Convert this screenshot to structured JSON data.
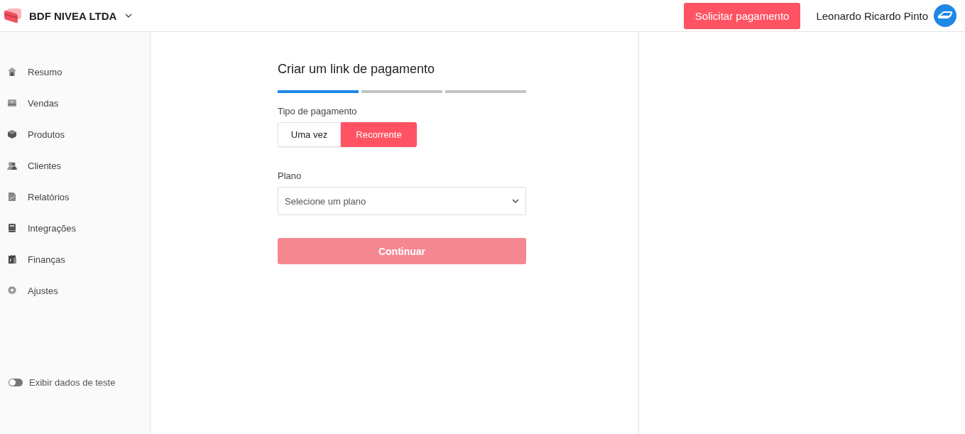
{
  "header": {
    "company": "BDF NIVEA LTDA",
    "request_button": "Solicitar pagamento",
    "user_name": "Leonardo Ricardo Pinto"
  },
  "sidebar": {
    "items": [
      {
        "label": "Resumo",
        "kind": "home"
      },
      {
        "label": "Vendas",
        "kind": "sales"
      },
      {
        "label": "Produtos",
        "kind": "box"
      },
      {
        "label": "Clientes",
        "kind": "people"
      },
      {
        "label": "Relatórios",
        "kind": "report"
      },
      {
        "label": "Integrações",
        "kind": "book"
      },
      {
        "label": "Finanças",
        "kind": "money"
      },
      {
        "label": "Ajustes",
        "kind": "gear"
      }
    ],
    "test_toggle": {
      "label": "Exibir dados de teste",
      "on": false
    }
  },
  "form": {
    "title": "Criar um link de pagamento",
    "steps": [
      {
        "current": true
      },
      {
        "current": false
      },
      {
        "current": false
      }
    ],
    "payment_type": {
      "label": "Tipo de pagamento",
      "options": [
        {
          "label": "Uma vez",
          "selected": false
        },
        {
          "label": "Recorrente",
          "selected": true
        }
      ]
    },
    "plan": {
      "label": "Plano",
      "placeholder": "Selecione um plano"
    },
    "continue_button": {
      "label": "Continuar",
      "disabled": true
    }
  }
}
